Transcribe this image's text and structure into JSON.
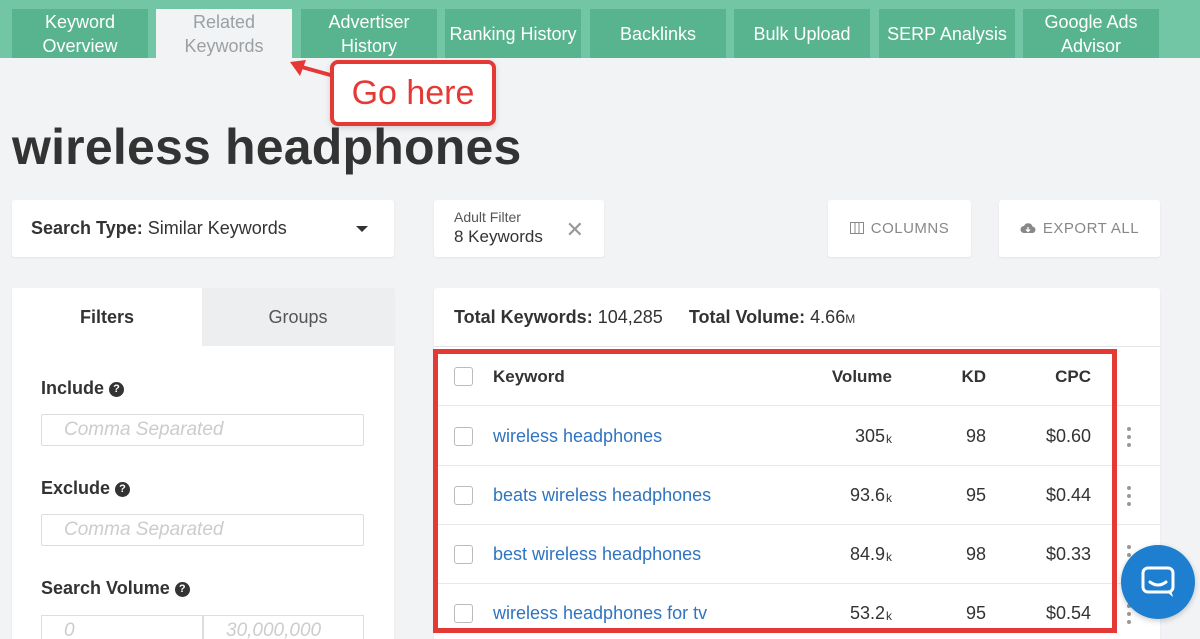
{
  "tabs": [
    {
      "line1": "Keyword",
      "line2": "Overview"
    },
    {
      "line1": "Related",
      "line2": "Keywords"
    },
    {
      "line1": "Advertiser",
      "line2": "History"
    },
    {
      "line1": "Ranking History",
      "line2": ""
    },
    {
      "line1": "Backlinks",
      "line2": ""
    },
    {
      "line1": "Bulk Upload",
      "line2": ""
    },
    {
      "line1": "SERP Analysis",
      "line2": ""
    },
    {
      "line1": "Google Ads",
      "line2": "Advisor"
    }
  ],
  "active_tab": "Related Keywords",
  "annotation": {
    "text": "Go here",
    "color": "#e53935"
  },
  "page_title": "wireless headphones",
  "search_type": {
    "label": "Search Type:",
    "value": "Similar Keywords"
  },
  "adult_filter": {
    "label": "Adult Filter",
    "value": "8 Keywords"
  },
  "buttons": {
    "columns": "COLUMNS",
    "export": "EXPORT ALL"
  },
  "filters_panel": {
    "tabs": {
      "filters": "Filters",
      "groups": "Groups"
    },
    "include": {
      "label": "Include",
      "placeholder": "Comma Separated"
    },
    "exclude": {
      "label": "Exclude",
      "placeholder": "Comma Separated"
    },
    "search_volume": {
      "label": "Search Volume",
      "min_placeholder": "0",
      "max_placeholder": "30,000,000"
    }
  },
  "totals": {
    "keywords_label": "Total Keywords:",
    "keywords_value": "104,285",
    "volume_label": "Total Volume:",
    "volume_value": "4.66",
    "volume_unit": "M"
  },
  "table": {
    "headers": {
      "keyword": "Keyword",
      "volume": "Volume",
      "kd": "KD",
      "cpc": "CPC"
    },
    "rows": [
      {
        "keyword": "wireless headphones",
        "volume": "305",
        "volume_unit": "k",
        "kd": "98",
        "cpc": "$0.60"
      },
      {
        "keyword": "beats wireless headphones",
        "volume": "93.6",
        "volume_unit": "k",
        "kd": "95",
        "cpc": "$0.44"
      },
      {
        "keyword": "best wireless headphones",
        "volume": "84.9",
        "volume_unit": "k",
        "kd": "98",
        "cpc": "$0.33"
      },
      {
        "keyword": "wireless headphones for tv",
        "volume": "53.2",
        "volume_unit": "k",
        "kd": "95",
        "cpc": "$0.54"
      }
    ]
  },
  "colors": {
    "tabbar": "#73c6a5",
    "tab": "#58b38f",
    "link": "#2f74c0",
    "highlight": "#e53935",
    "chat": "#1e7fd0"
  },
  "icons": {
    "columns": "columns-icon",
    "export": "cloud-download-icon",
    "help": "question-circle-icon",
    "chat": "chat-icon",
    "close": "close-icon"
  }
}
